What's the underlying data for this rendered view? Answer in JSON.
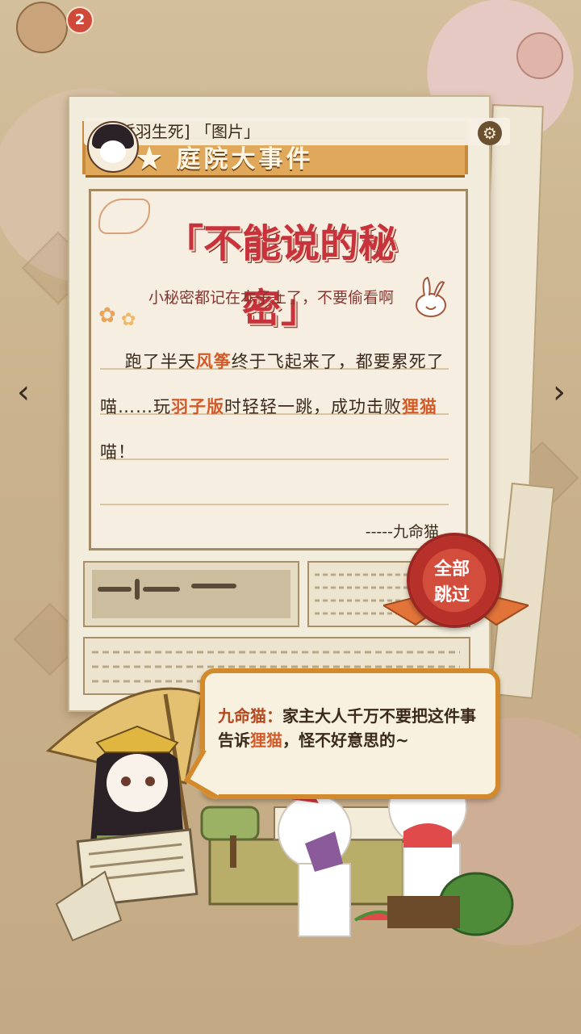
{
  "top": {
    "badge_count": "2"
  },
  "tag": {
    "text": "[哲羽生死] 「图片」"
  },
  "header": {
    "title": "★ 庭院大事件"
  },
  "letter": {
    "title": "「不能说的秘密」",
    "subtitle": "小秘密都记在本子上了，不要偷看啊",
    "body": [
      {
        "t": "跑了半天",
        "h": false
      },
      {
        "t": "风筝",
        "h": true
      },
      {
        "t": "终于飞起来了，都要累死了喵……玩",
        "h": false
      },
      {
        "t": "羽子版",
        "h": true
      },
      {
        "t": "时轻轻一跳，成功击败",
        "h": false
      },
      {
        "t": "狸猫",
        "h": true
      },
      {
        "t": "喵！",
        "h": false
      }
    ],
    "signature": "-----九命猫"
  },
  "skip": {
    "line1": "全部",
    "line2": "跳过"
  },
  "dialogue": {
    "speaker": "九命猫：",
    "parts": [
      {
        "t": "家主大人千万不要把这件事告诉",
        "h": false
      },
      {
        "t": "狸猫",
        "h": true
      },
      {
        "t": "，怪不好意思的~",
        "h": false
      }
    ]
  },
  "nav": {
    "prev": "‹",
    "next": "›"
  },
  "icons": {
    "settings": "gear-icon"
  },
  "colors": {
    "accent": "#d38a2d",
    "highlight": "#d35b2a",
    "title_red": "#c8323c"
  }
}
